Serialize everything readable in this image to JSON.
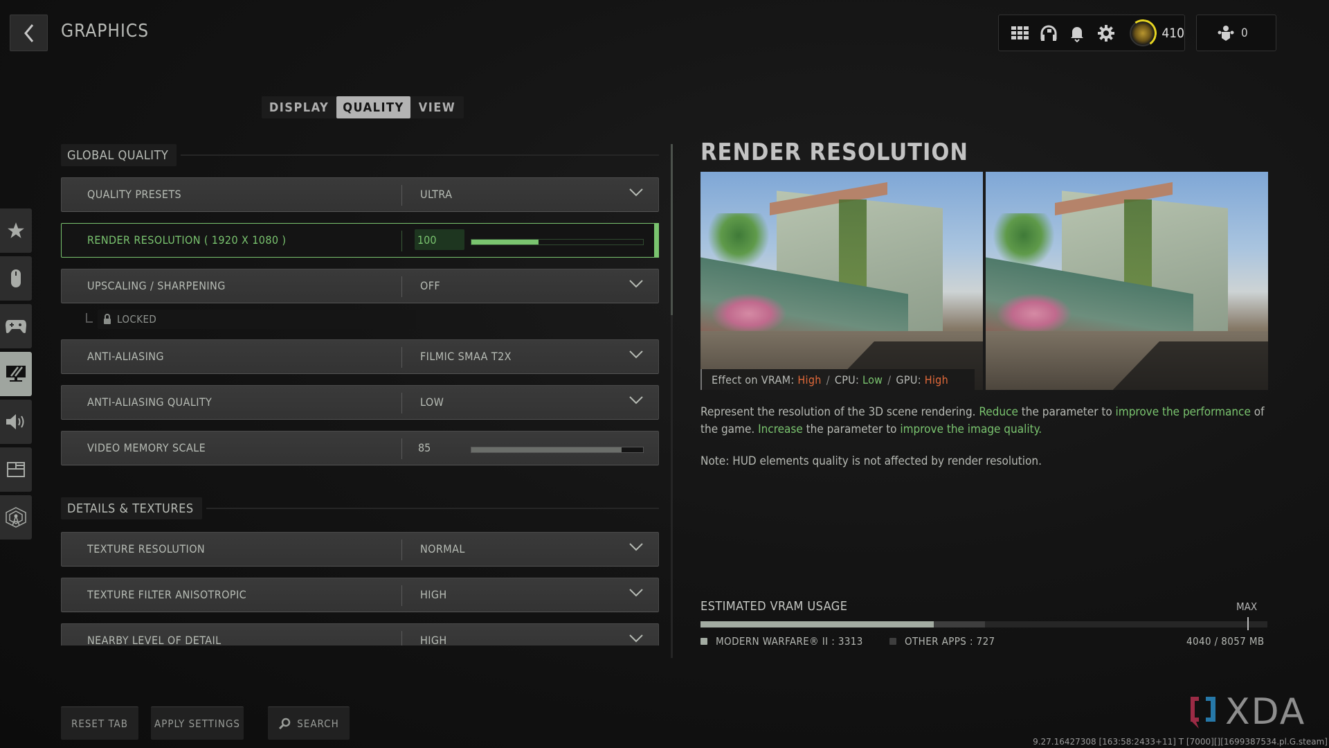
{
  "header": {
    "title": "GRAPHICS",
    "top_icons": [
      "grid-menu-icon",
      "headset-icon",
      "bell-icon",
      "gear-icon"
    ],
    "rank_level": "410",
    "party_count": "0"
  },
  "tabs": [
    {
      "label": "DISPLAY",
      "active": false
    },
    {
      "label": "QUALITY",
      "active": true
    },
    {
      "label": "VIEW",
      "active": false
    }
  ],
  "sidebar": {
    "items": [
      {
        "name": "favorites",
        "icon": "star-icon",
        "active": false
      },
      {
        "name": "mouse",
        "icon": "mouse-icon",
        "active": false
      },
      {
        "name": "controller",
        "icon": "gamepad-icon",
        "active": false
      },
      {
        "name": "graphics",
        "icon": "monitor-icon",
        "active": true
      },
      {
        "name": "audio",
        "icon": "speaker-icon",
        "active": false
      },
      {
        "name": "interface",
        "icon": "layout-icon",
        "active": false
      },
      {
        "name": "network",
        "icon": "antenna-icon",
        "active": false
      }
    ]
  },
  "sections": {
    "global_quality": {
      "title": "GLOBAL QUALITY",
      "quality_presets": {
        "label": "QUALITY PRESETS",
        "value": "ULTRA"
      },
      "render_resolution": {
        "label": "RENDER RESOLUTION ( 1920 X 1080 )",
        "value": "100",
        "slider_fraction": 0.39
      },
      "upscaling": {
        "label": "UPSCALING / SHARPENING",
        "value": "OFF"
      },
      "upscaling_sub": {
        "label": "LOCKED"
      },
      "anti_aliasing": {
        "label": "ANTI-ALIASING",
        "value": "FILMIC SMAA T2X"
      },
      "anti_aliasing_quality": {
        "label": "ANTI-ALIASING QUALITY",
        "value": "LOW"
      },
      "video_memory_scale": {
        "label": "VIDEO MEMORY SCALE",
        "value": "85",
        "slider_fraction": 0.875
      }
    },
    "details_textures": {
      "title": "DETAILS & TEXTURES",
      "texture_resolution": {
        "label": "TEXTURE RESOLUTION",
        "value": "NORMAL"
      },
      "texture_filter": {
        "label": "TEXTURE FILTER ANISOTROPIC",
        "value": "HIGH"
      },
      "nearby_lod": {
        "label": "NEARBY LEVEL OF DETAIL",
        "value": "HIGH"
      }
    }
  },
  "detail": {
    "title": "RENDER RESOLUTION",
    "effect": {
      "prefix": "Effect on VRAM:",
      "vram": "High",
      "cpu_label": "CPU:",
      "cpu": "Low",
      "gpu_label": "GPU:",
      "gpu": "High",
      "separator": "/"
    },
    "description": {
      "p1": "Represent the resolution of the 3D scene rendering. ",
      "g1": "Reduce",
      "p2": " the parameter to ",
      "g2": "improve the performance",
      "p3": " of the game. ",
      "g3": "Increase",
      "p4": " the parameter to ",
      "g4": "improve the image quality."
    },
    "note": "Note: HUD elements quality is not affected by render resolution."
  },
  "vram": {
    "label": "ESTIMATED VRAM USAGE",
    "max_label": "MAX",
    "game_label": "MODERN WARFARE® II : 3313",
    "other_label": "OTHER APPS : 727",
    "total_label": "4040 / 8057 MB",
    "game_mb": 3313,
    "other_mb": 727,
    "total_mb": 8057,
    "max_fraction": 0.965,
    "colors": {
      "game": "#a3aca2",
      "other": "#3e3e3e"
    }
  },
  "footer": {
    "reset_label": "RESET TAB",
    "apply_label": "APPLY SETTINGS",
    "search_label": "SEARCH"
  },
  "watermark": {
    "logo_text": "XDA",
    "build_info": "9.27.16427308 [163:58:2433+11] T [7000][][1699387534.pl.G.steam]"
  },
  "colors": {
    "accent_green": "#7ac46f",
    "warning_orange": "#e2693a"
  }
}
